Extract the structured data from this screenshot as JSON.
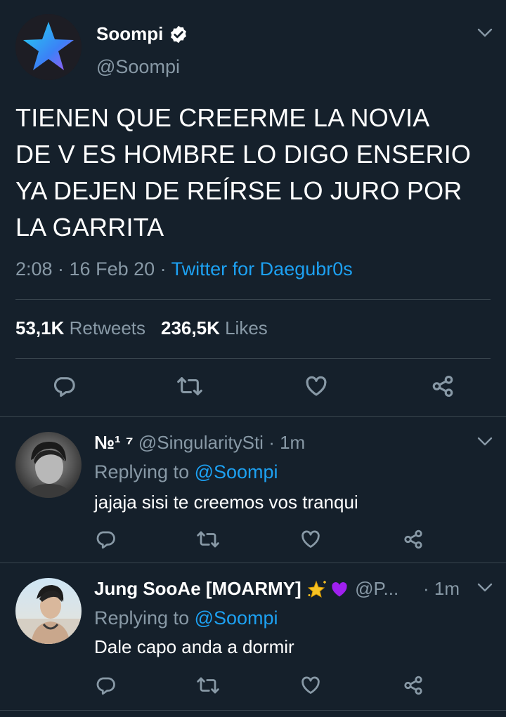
{
  "main_tweet": {
    "display_name": "Soompi",
    "handle": "@Soompi",
    "text": "TIENEN QUE CREERME LA NOVIA DE V ES HOMBRE LO DIGO ENSERIO YA DEJEN DE REÍRSE LO JURO POR LA GARRITA",
    "text_lines": [
      "TIENEN QUE CREERME LA NOVIA",
      "DE V ES HOMBRE LO DIGO ENSERIO",
      "YA DEJEN DE REÍRSE LO JURO POR",
      "LA GARRITA"
    ],
    "time": "2:08 · 16 Feb 20 · ",
    "source": "Twitter for Daegubr0s",
    "retweets_count": "53,1K",
    "retweets_label": "Retweets",
    "likes_count": "236,5K",
    "likes_label": "Likes"
  },
  "replies": [
    {
      "display_name": "№¹ ⁷",
      "handle": "@SingularitySti",
      "time": "· 1m",
      "replying_prefix": "Replying to ",
      "replying_to": "@Soompi",
      "text": "jajaja sisi te creemos vos tranqui"
    },
    {
      "display_name": "Jung SooAe [MOARMY]",
      "emoji": "🌟💜",
      "handle": "@P...",
      "time": "· 1m",
      "replying_prefix": "Replying to ",
      "replying_to": "@Soompi",
      "text": "Dale capo anda a dormir"
    }
  ],
  "icons": [
    "reply-icon",
    "retweet-icon",
    "like-icon",
    "share-icon",
    "chevron-down-icon",
    "verified-icon"
  ],
  "colors": {
    "background": "#15202b",
    "muted": "#8899a6",
    "accent": "#1da1f2",
    "divider": "#38444d"
  }
}
